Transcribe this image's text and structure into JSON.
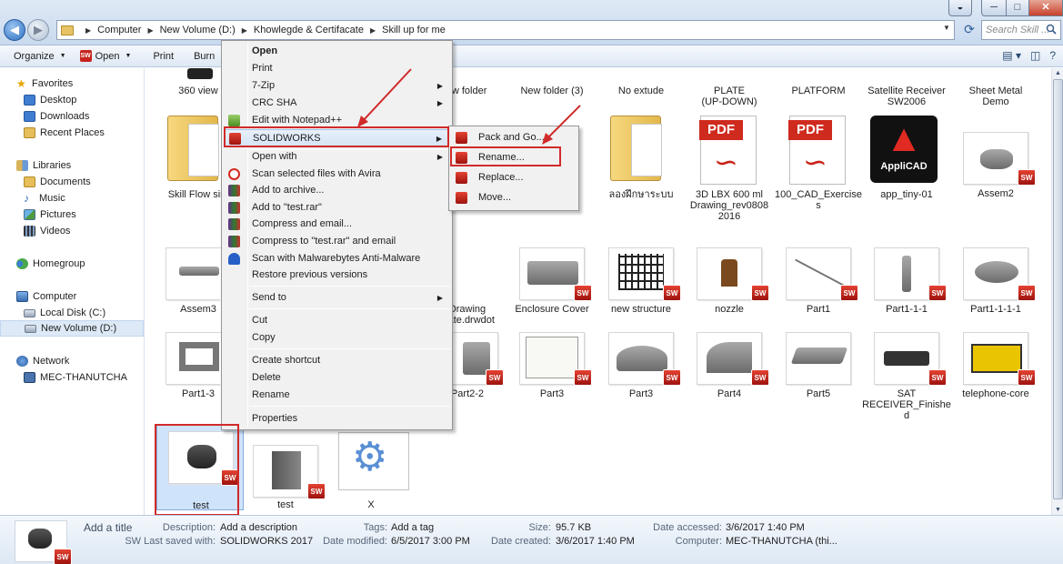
{
  "window": {
    "buttons": {
      "minimize": "─",
      "maximize": "□",
      "close": "✕",
      "extra": "◒"
    }
  },
  "address": {
    "crumbs": [
      "Computer",
      "New Volume (D:)",
      "Khowlegde & Certifacate",
      "Skill up for me"
    ],
    "search_placeholder": "Search Skill ..."
  },
  "toolbar": {
    "organize": "Organize",
    "open": "Open",
    "print": "Print",
    "burn": "Burn"
  },
  "sidebar": {
    "favorites": "Favorites",
    "fav_items": [
      "Desktop",
      "Downloads",
      "Recent Places"
    ],
    "libraries": "Libraries",
    "lib_items": [
      "Documents",
      "Music",
      "Pictures",
      "Videos"
    ],
    "homegroup": "Homegroup",
    "computer": "Computer",
    "computer_items": [
      "Local Disk (C:)",
      "New Volume (D:)"
    ],
    "network": "Network",
    "network_items": [
      "MEC-THANUTCHA"
    ]
  },
  "files": {
    "row0": [
      "360 view",
      "new folder",
      "New folder (3)",
      "No extude",
      "PLATE\n(UP-DOWN)",
      "PLATFORM",
      "Satellite Receiver\nSW2006",
      "Sheet Metal\nDemo"
    ],
    "row1": [
      "Skill Flow sim",
      "ลองฝึกษาระบบ",
      "3D LBX 600 ml\nDrawing_rev0808\n2016",
      "100_CAD_Exercise\ns",
      "app_tiny-01",
      "Assem2"
    ],
    "row2": [
      "Assem3",
      "Drawing\nplate.drwdot",
      "Enclosure Cover",
      "new structure",
      "nozzle",
      "Part1",
      "Part1-1-1",
      "Part1-1-1-1"
    ],
    "row3": [
      "Part1-3",
      "Part2-2",
      "Part3",
      "Part3",
      "Part4",
      "Part5",
      "SAT\nRECEIVER_Finishe\nd",
      "telephone-core"
    ],
    "row4": [
      "test",
      "test",
      "X"
    ],
    "pdf_label": "PDF",
    "appli_label": "AppliCAD",
    "sw_badge": "SW"
  },
  "context_menu": {
    "items": [
      "Open",
      "Print",
      "7-Zip",
      "CRC SHA",
      "Edit with Notepad++",
      "SOLIDWORKS",
      "Open with",
      "Scan selected files with Avira",
      "Add to archive...",
      "Add to \"test.rar\"",
      "Compress and email...",
      "Compress to \"test.rar\" and email",
      "Scan with Malwarebytes Anti-Malware",
      "Restore previous versions",
      "Send to",
      "Cut",
      "Copy",
      "Create shortcut",
      "Delete",
      "Rename",
      "Properties"
    ]
  },
  "solidworks_submenu": {
    "items": [
      "Pack and Go...",
      "Rename...",
      "Replace...",
      "Move..."
    ]
  },
  "details": {
    "add_title": "Add a title",
    "description_label": "Description:",
    "description_value": "Add a description",
    "sw_saved_label": "SW Last saved with:",
    "sw_saved_value": "SOLIDWORKS 2017",
    "tags_label": "Tags:",
    "tags_value": "Add a tag",
    "modified_label": "Date modified:",
    "modified_value": "6/5/2017 3:00 PM",
    "size_label": "Size:",
    "size_value": "95.7 KB",
    "created_label": "Date created:",
    "created_value": "3/6/2017 1:40 PM",
    "accessed_label": "Date accessed:",
    "accessed_value": "3/6/2017 1:40 PM",
    "computer_label": "Computer:",
    "computer_value": "MEC-THANUTCHA (thi..."
  },
  "colors": {
    "annotation": "#d12a2a",
    "selection": "#cfe3fb",
    "solidworks_red": "#c7231c"
  }
}
